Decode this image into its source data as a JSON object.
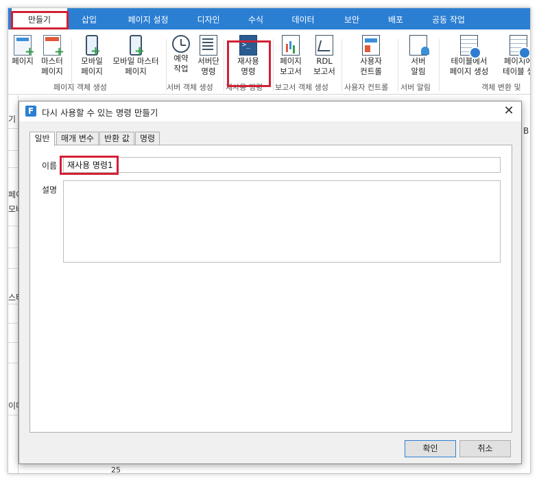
{
  "ribbon_tabs": [
    {
      "label": "만들기",
      "active": true
    },
    {
      "label": "삽입"
    },
    {
      "label": "페이지 설정"
    },
    {
      "label": "디자인"
    },
    {
      "label": "수식"
    },
    {
      "label": "데이터"
    },
    {
      "label": "보안"
    },
    {
      "label": "배포"
    },
    {
      "label": "공동 작업"
    }
  ],
  "ribbon": {
    "buttons": [
      {
        "line1": "페이지",
        "line2": "",
        "icon": "page-add-icon"
      },
      {
        "line1": "마스터",
        "line2": "페이지",
        "icon": "master-page-icon"
      },
      {
        "line1": "모바일",
        "line2": "페이지",
        "icon": "mobile-page-icon"
      },
      {
        "line1": "모바일 마스터",
        "line2": "페이지",
        "icon": "mobile-master-page-icon"
      },
      {
        "line1": "예약",
        "line2": "작업",
        "icon": "clock-icon"
      },
      {
        "line1": "서버단",
        "line2": "명령",
        "icon": "server-command-icon"
      },
      {
        "line1": "재사용",
        "line2": "명령",
        "icon": "reusable-command-icon"
      },
      {
        "line1": "페이지",
        "line2": "보고서",
        "icon": "page-report-icon"
      },
      {
        "line1": "RDL",
        "line2": "보고서",
        "icon": "rdl-report-icon"
      },
      {
        "line1": "사용자",
        "line2": "컨트롤",
        "icon": "user-control-icon"
      },
      {
        "line1": "서버",
        "line2": "알림",
        "icon": "server-alert-icon"
      },
      {
        "line1": "테이블에서",
        "line2": "페이지 생성",
        "icon": "table-to-page-icon"
      },
      {
        "line1": "페이지에",
        "line2": "테이블 생",
        "icon": "page-to-table-icon"
      }
    ],
    "groups": [
      {
        "label": "페이지 객체 생성"
      },
      {
        "label": "서버 객체 생성"
      },
      {
        "label": "재사용 명령"
      },
      {
        "label": "보고서 객체 생성"
      },
      {
        "label": "사용자 컨트롤"
      },
      {
        "label": "서버 알림"
      },
      {
        "label": "객체 변환 및"
      }
    ]
  },
  "background": {
    "left_fragments": [
      "기",
      "페이",
      "모바",
      "스터",
      "이미"
    ],
    "right_fragment": "B",
    "bottom_fragment": "25"
  },
  "dialog": {
    "logo_letter": "F",
    "title": "다시 사용할 수 있는 명령 만들기",
    "close_glyph": "✕",
    "tabs": [
      {
        "label": "일반",
        "active": true
      },
      {
        "label": "매개 변수"
      },
      {
        "label": "반환 값"
      },
      {
        "label": "명령"
      }
    ],
    "name_label": "이름",
    "name_value": "재사용 명령1",
    "description_label": "설명",
    "description_value": "",
    "ok_label": "확인",
    "cancel_label": "취소"
  },
  "colors": {
    "ribbon_blue": "#2b7fd3",
    "highlight_red": "#d21f34"
  }
}
